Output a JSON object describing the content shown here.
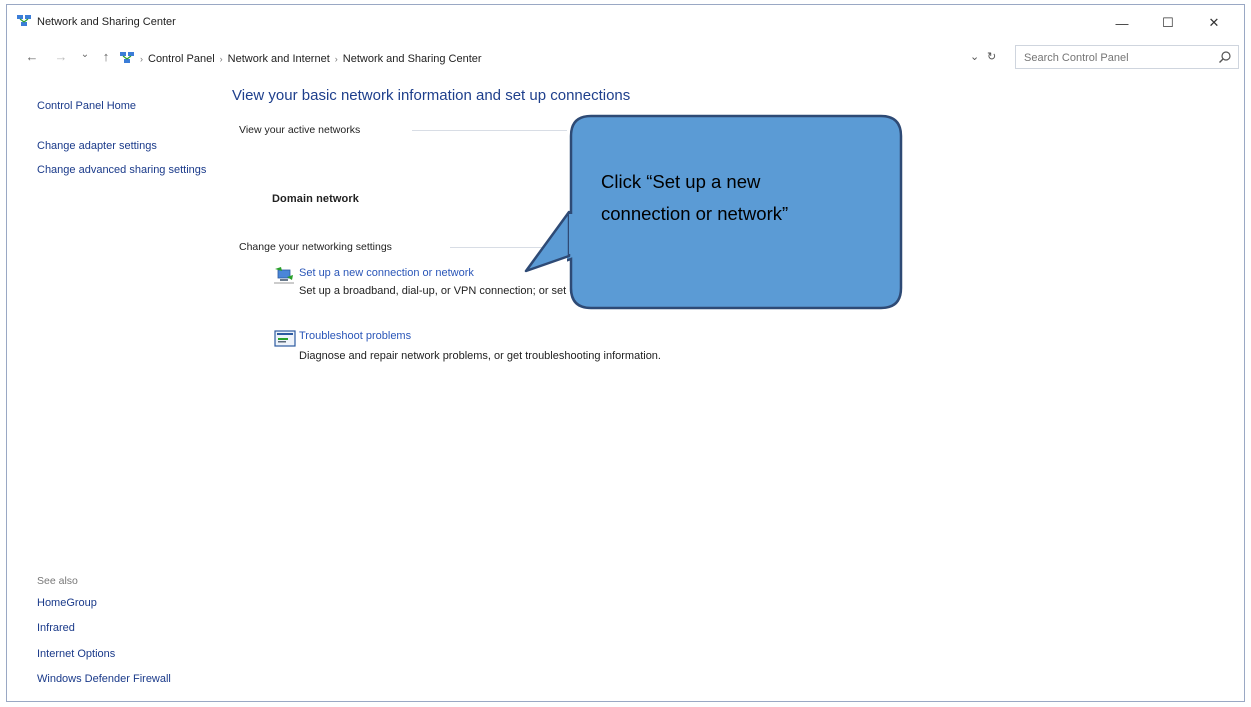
{
  "window": {
    "title": "Network and Sharing Center",
    "minimize": "—",
    "maximize": "☐",
    "close": "✕"
  },
  "nav": {
    "back": "←",
    "forward": "→",
    "recent": "⌄",
    "up": "↑",
    "breadcrumb": [
      "Control Panel",
      "Network and Internet",
      "Network and Sharing Center"
    ],
    "dropdown": "⌄",
    "refresh": "↻",
    "search_placeholder": "Search Control Panel"
  },
  "sidebar": {
    "home": "Control Panel Home",
    "links": [
      "Change adapter settings",
      "Change advanced sharing settings"
    ],
    "see_also_label": "See also",
    "see_also": [
      "HomeGroup",
      "Infrared",
      "Internet Options",
      "Windows Defender Firewall"
    ]
  },
  "main": {
    "title": "View your basic network information and set up connections",
    "active_networks_label": "View your active networks",
    "network_name": "Domain network",
    "change_settings_label": "Change your networking settings",
    "items": [
      {
        "link": "Set up a new connection or network",
        "description": "Set up a broadband, dial-up, or VPN connection; or set up a router or access point.",
        "icon": "network-setup-icon"
      },
      {
        "link": "Troubleshoot problems",
        "description": "Diagnose and repair network problems, or get troubleshooting information.",
        "icon": "troubleshoot-icon"
      }
    ]
  },
  "callout": {
    "line1": "Click “Set up a new",
    "line2": "connection or network”",
    "fill": "#5b9bd5",
    "stroke": "#2e4a75"
  }
}
